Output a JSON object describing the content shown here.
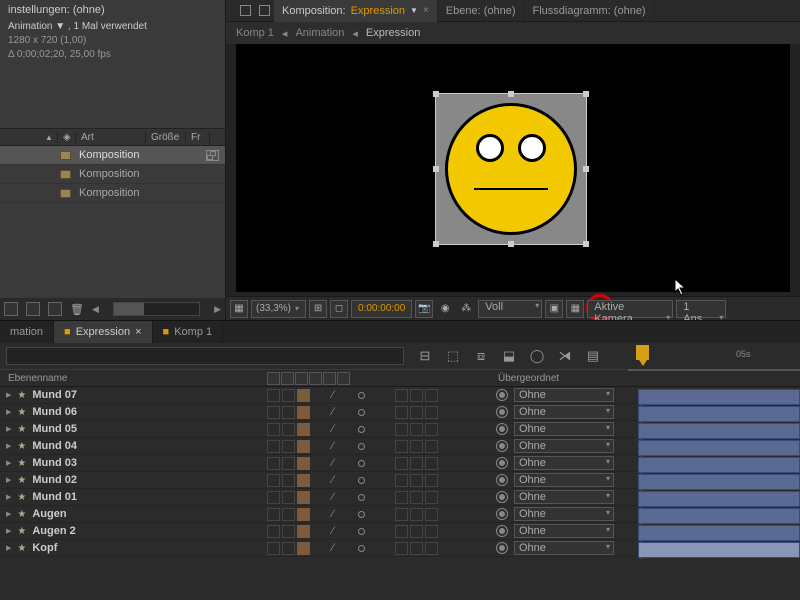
{
  "project": {
    "settings": "instellungen: (ohne)",
    "title": "Animation ▼ , 1 Mal verwendet",
    "dims": "1280 x 720 (1,00)",
    "dur": "Δ 0;00;02;20, 25,00 fps",
    "cols": {
      "art": "Art",
      "groesse": "Größe",
      "fr": "Fr"
    },
    "items": [
      "Komposition",
      "Komposition",
      "Komposition"
    ]
  },
  "comp_tabs": {
    "prefix": "Komposition:",
    "active": "Expression",
    "others": [
      "Ebene: (ohne)",
      "Flussdiagramm: (ohne)"
    ]
  },
  "breadcrumb": [
    "Komp 1",
    "Animation",
    "Expression"
  ],
  "viewer": {
    "zoom": "(33,3%)",
    "time": "0:00:00:00",
    "res": "Voll",
    "camera": "Aktive Kamera",
    "views": "1 Ans..."
  },
  "timeline": {
    "tabs": [
      "mation",
      "Expression",
      "Komp 1"
    ],
    "active": 1,
    "cols": {
      "name": "Ebenenname",
      "parent": "Übergeordnet"
    },
    "parent_none": "Ohne",
    "ruler": {
      "t1": "05s"
    },
    "layers": [
      {
        "name": "Mund 07"
      },
      {
        "name": "Mund 06"
      },
      {
        "name": "Mund 05"
      },
      {
        "name": "Mund 04"
      },
      {
        "name": "Mund 03"
      },
      {
        "name": "Mund 02"
      },
      {
        "name": "Mund 01"
      },
      {
        "name": "Augen"
      },
      {
        "name": "Augen 2"
      },
      {
        "name": "Kopf"
      }
    ]
  }
}
